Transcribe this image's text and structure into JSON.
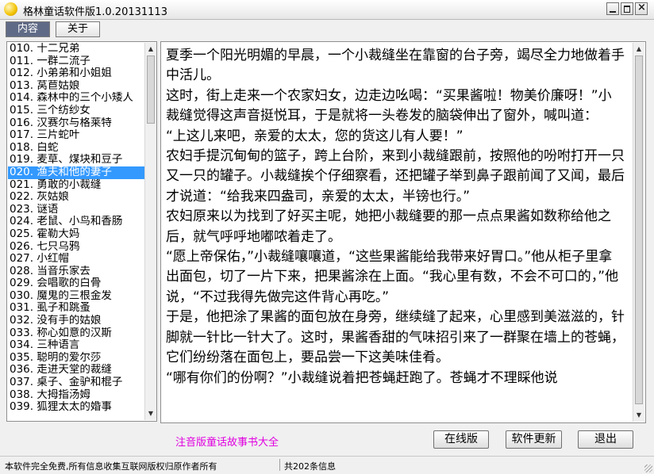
{
  "window": {
    "title": "格林童话软件版1.0.20131113",
    "close_glyph": "×"
  },
  "tabs": [
    {
      "label": "内容"
    },
    {
      "label": "关于"
    }
  ],
  "story_list": {
    "selected_index": 10,
    "items": [
      "010. 十二兄弟",
      "011. 一群二流子",
      "012. 小弟弟和小姐姐",
      "013. 莴苣姑娘",
      "014. 森林中的三个小矮人",
      "015. 三个纺纱女",
      "016. 汉赛尔与格莱特",
      "017. 三片蛇叶",
      "018. 白蛇",
      "019. 麦草、煤块和豆子",
      "020. 渔夫和他的妻子",
      "021. 勇敢的小裁缝",
      "022. 灰姑娘",
      "023. 谜语",
      "024. 老鼠、小鸟和香肠",
      "025. 霍勒大妈",
      "026. 七只乌鸦",
      "027. 小红帽",
      "028. 当音乐家去",
      "029. 会唱歌的白骨",
      "030. 魔鬼的三根金发",
      "031. 虱子和跳蚤",
      "032. 没有手的姑娘",
      "033. 称心如意的汉斯",
      "034. 三种语言",
      "035. 聪明的爱尔莎",
      "036. 走进天堂的裁缝",
      "037. 桌子、金驴和棍子",
      "038. 大拇指汤姆",
      "039. 狐狸太太的婚事"
    ]
  },
  "story_text": "夏季一个阳光明媚的早晨，一个小裁缝坐在靠窗的台子旁，竭尽全力地做着手中活儿。\n这时，街上走来一个农家妇女，边走边吆喝：“买果酱啦！物美价廉呀！”小裁缝觉得这声音挺悦耳，于是就将一头卷发的脑袋伸出了窗外，喊叫道：\n“上这儿来吧，亲爱的太太，您的货这儿有人要！”\n农妇手提沉甸甸的篮子，跨上台阶，来到小裁缝跟前，按照他的吩咐打开一只又一只的罐子。小裁缝挨个仔细察看，还把罐子举到鼻子跟前闻了又闻，最后才说道：“给我来四盎司，亲爱的太太，半镑也行。”\n农妇原来以为找到了好买主呢，她把小裁缝要的那一点点果酱如数称给他之后，就气呼呼地嘟哝着走了。\n“愿上帝保佑，”小裁缝嚷嚷道，“这些果酱能给我带来好胃口。”他从柜子里拿出面包，切了一片下来，把果酱涂在上面。“我心里有数，不会不可口的，”他说，“不过我得先做完这件背心再吃。”\n于是，他把涂了果酱的面包放在身旁，继续缝了起来，心里感到美滋滋的，针脚就一针比一针大了。这时，果酱香甜的气味招引来了一群聚在墙上的苍蝇，它们纷纷落在面包上，要品尝一下这美味佳肴。\n“哪有你们的份啊？”小裁缝说着把苍蝇赶跑了。苍蝇才不理睬他说",
  "footer": {
    "title": "注音版童话故事书大全",
    "buttons": {
      "online": "在线版",
      "update": "软件更新",
      "exit": "退出"
    }
  },
  "statusbar": {
    "left": "本软件完全免费,所有信息收集互联网版权归原作者所有",
    "right": "共202条信息"
  },
  "colors": {
    "selection": "#3399ff",
    "footer_title": "#e000e0",
    "active_tab": "#5f6a86"
  }
}
